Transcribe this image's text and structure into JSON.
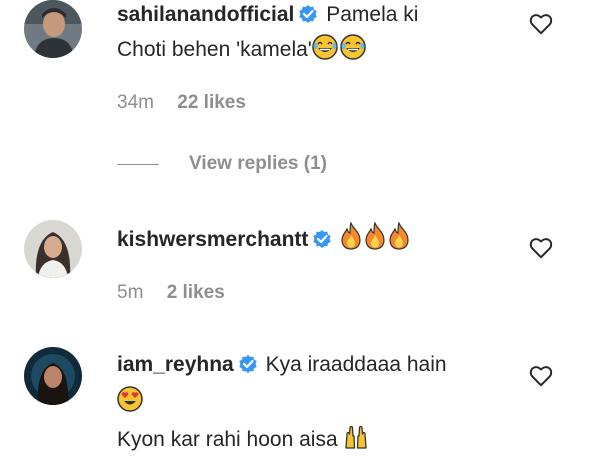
{
  "comments": [
    {
      "username": "sahilanandofficial",
      "text_line1": "Pamela ki",
      "text_line2": "Choti behen 'kamela'",
      "emojis": [
        "face-with-tears-of-joy",
        "face-with-tears-of-joy"
      ],
      "time": "34m",
      "likes": "22 likes",
      "view_replies": "View replies (1)"
    },
    {
      "username": "kishwersmerchantt",
      "emojis": [
        "fire",
        "fire",
        "fire"
      ],
      "time": "5m",
      "likes": "2 likes"
    },
    {
      "username": "iam_reyhna",
      "text_line1": "Kya iraaddaaa hain",
      "emojis_line2": [
        "smiling-face-with-heart-eyes"
      ],
      "text_line3": "Kyon kar rahi hoon aisa",
      "emojis_line3": [
        "raising-hands"
      ]
    }
  ],
  "colors": {
    "verified": "#3897f0",
    "meta": "#8e8e8e",
    "text": "#262626"
  }
}
